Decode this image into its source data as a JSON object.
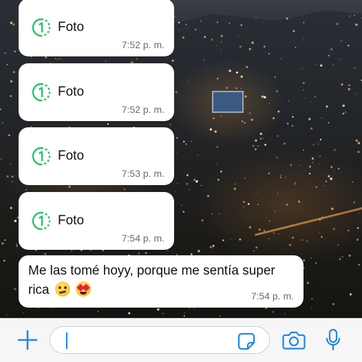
{
  "chat": {
    "messages": [
      {
        "type": "photo",
        "label": "Foto",
        "time": "7:52 p. m.",
        "icon": "view-once-icon"
      },
      {
        "type": "photo",
        "label": "Foto",
        "time": "7:52 p. m.",
        "icon": "view-once-icon"
      },
      {
        "type": "photo",
        "label": "Foto",
        "time": "7:53 p. m.",
        "icon": "view-once-icon"
      },
      {
        "type": "photo",
        "label": "Foto",
        "time": "7:54 p. m.",
        "icon": "view-once-icon"
      },
      {
        "type": "text",
        "text": "Me las tomé hoyy, porque me sentía super rica",
        "emojis": [
          "woozy-face-emoji",
          "heart-eyes-emoji"
        ],
        "time": "7:54 p. m."
      }
    ]
  },
  "input_bar": {
    "icons": [
      "plus-icon",
      "sticker-icon",
      "camera-icon",
      "microphone-icon"
    ],
    "value": ""
  },
  "colors": {
    "accent_green": "#25c266",
    "accent_blue": "#1b86f0",
    "bubble": "#ffffff",
    "timestamp": "#6b6b6b"
  }
}
